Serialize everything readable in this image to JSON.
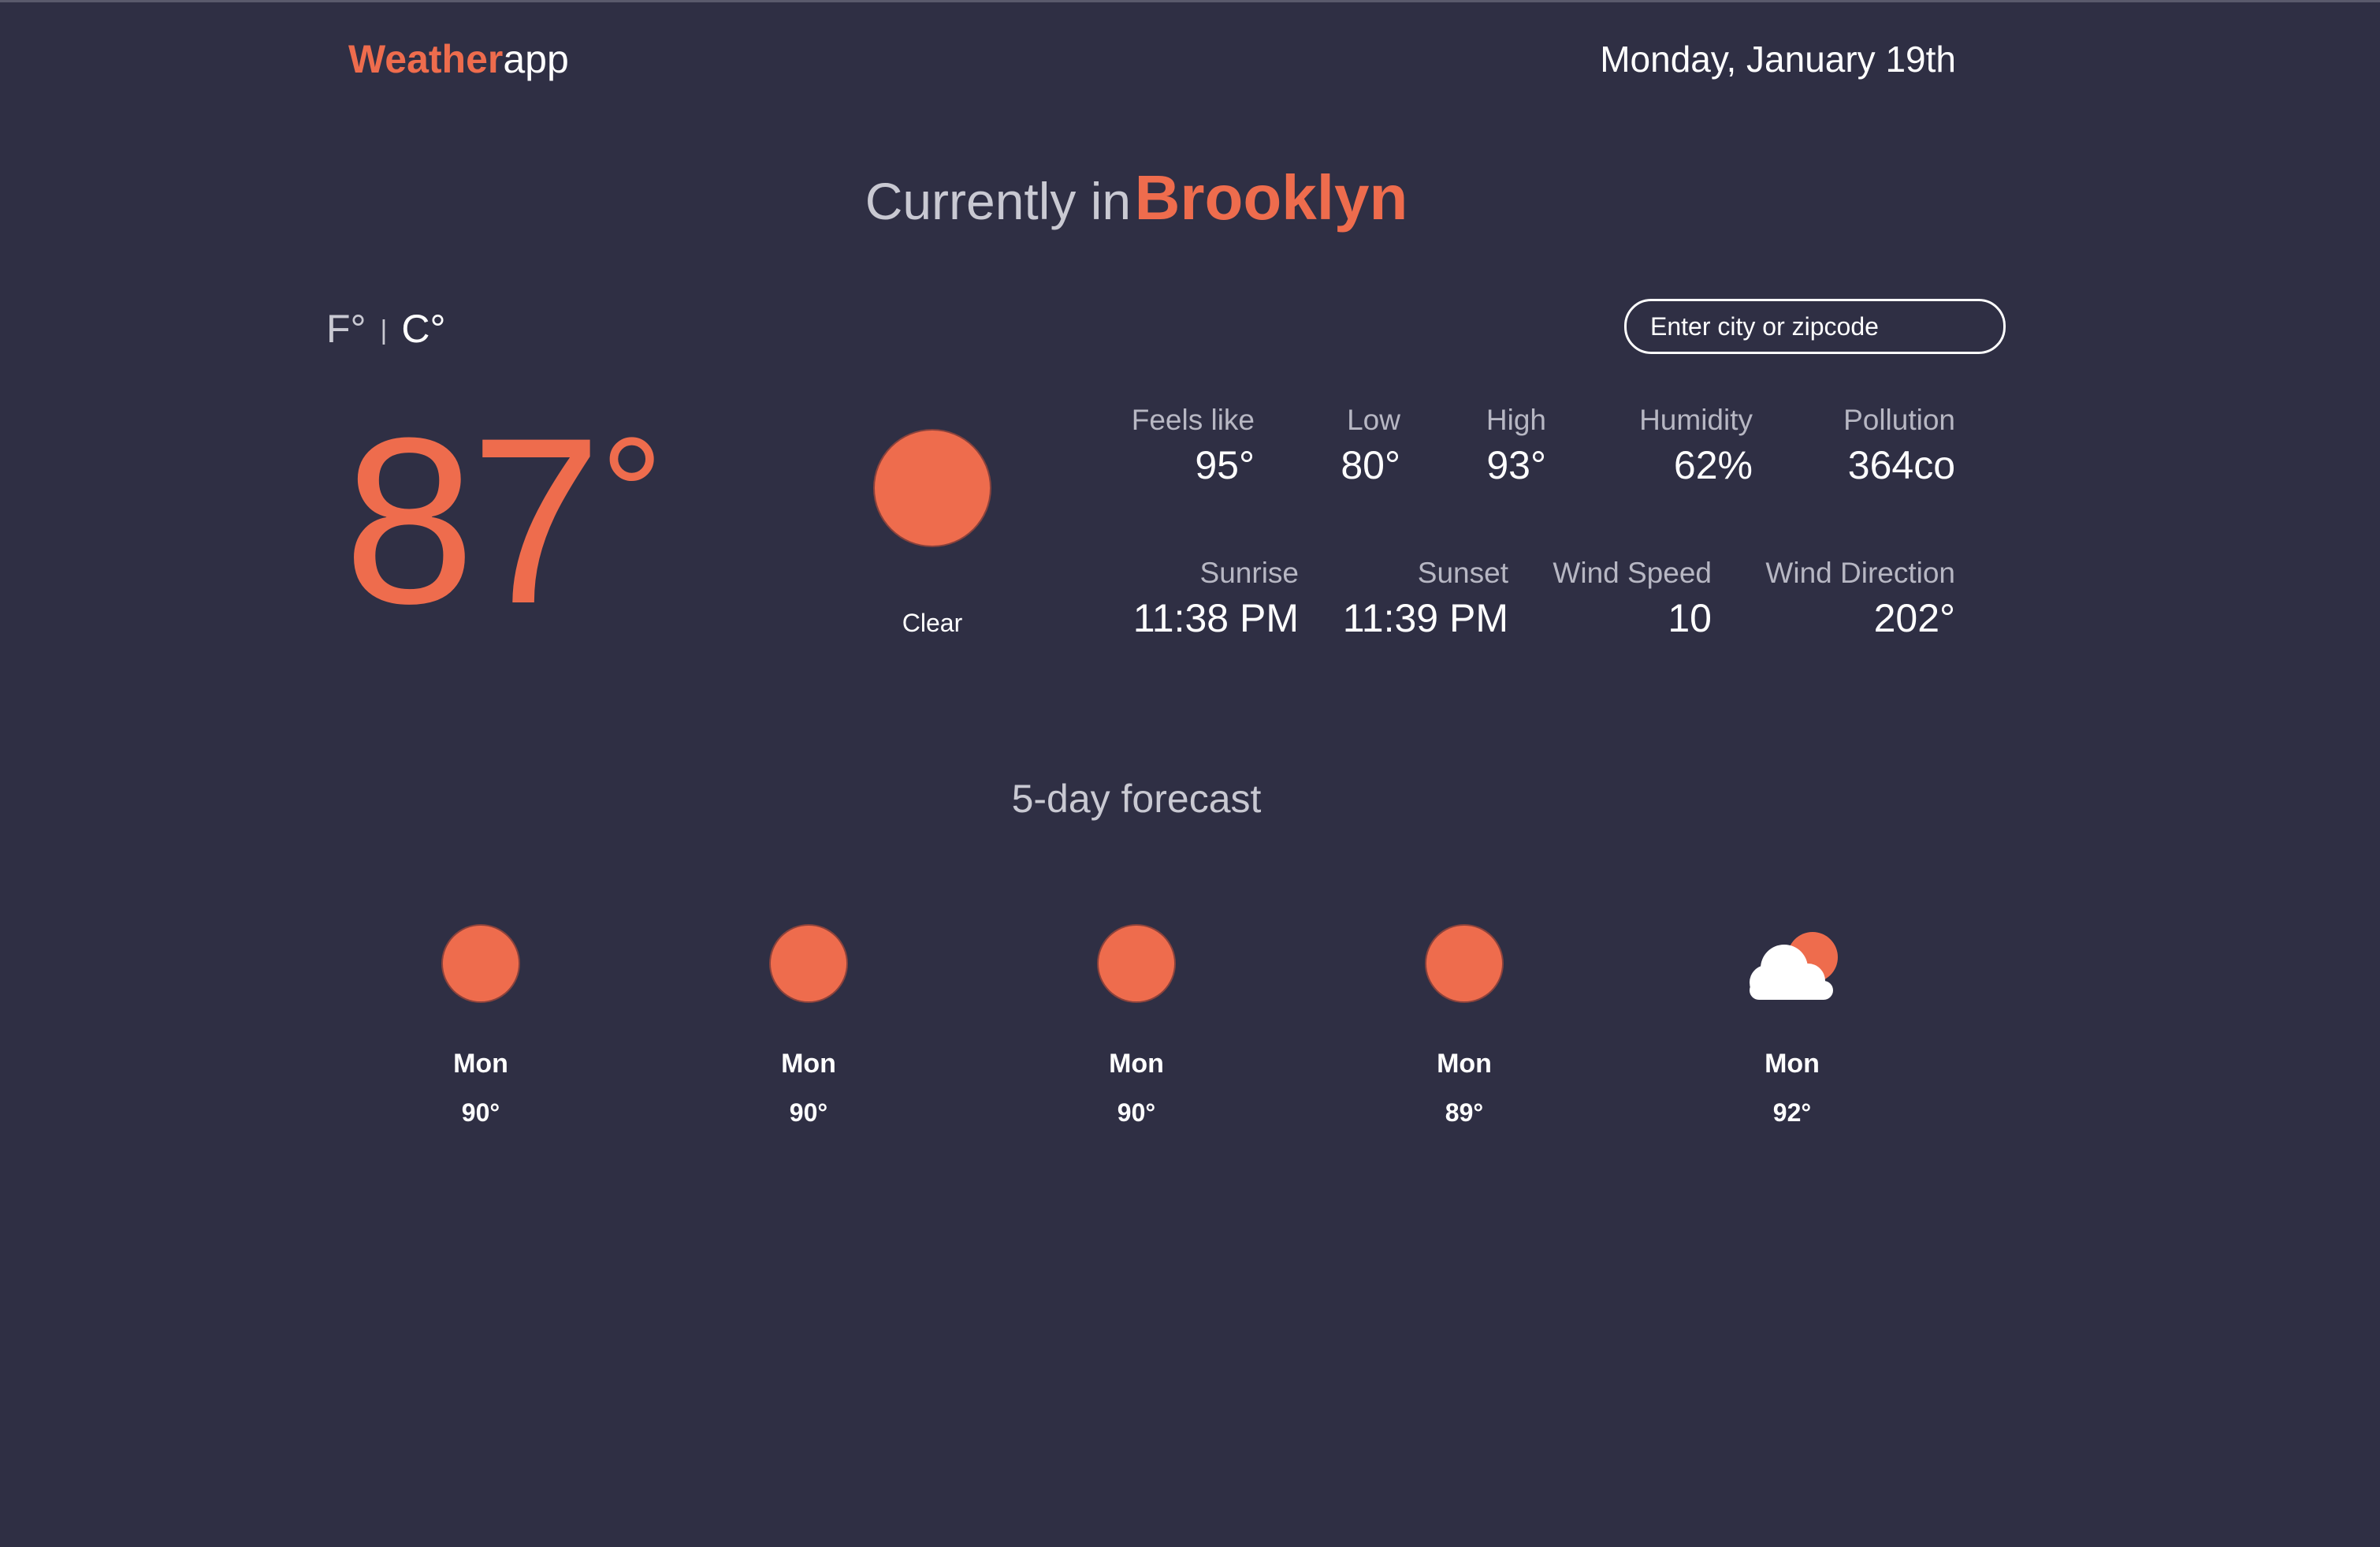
{
  "header": {
    "logo_strong": "Weather",
    "logo_light": "app",
    "date": "Monday, January 19th"
  },
  "headline": {
    "prefix": "Currently in",
    "city": "Brooklyn"
  },
  "units": {
    "fahrenheit": "F°",
    "separator": "|",
    "celsius": "C°"
  },
  "search": {
    "placeholder": "Enter city or zipcode"
  },
  "current": {
    "temperature": "87",
    "degree_symbol": "°",
    "condition": "Clear",
    "icon": "sun-icon"
  },
  "stats": {
    "feels_like": {
      "label": "Feels like",
      "value": "95°"
    },
    "low": {
      "label": "Low",
      "value": "80°"
    },
    "high": {
      "label": "High",
      "value": "93°"
    },
    "humidity": {
      "label": "Humidity",
      "value": "62%"
    },
    "pollution": {
      "label": "Pollution",
      "value": "364co"
    },
    "sunrise": {
      "label": "Sunrise",
      "value": "11:38 PM"
    },
    "sunset": {
      "label": "Sunset",
      "value": "11:39 PM"
    },
    "wind_speed": {
      "label": "Wind Speed",
      "value": "10"
    },
    "wind_direction": {
      "label": "Wind Direction",
      "value": "202°"
    }
  },
  "forecast": {
    "title": "5-day forecast",
    "days": [
      {
        "day": "Mon",
        "temp": "90°",
        "icon": "sun-icon"
      },
      {
        "day": "Mon",
        "temp": "90°",
        "icon": "sun-icon"
      },
      {
        "day": "Mon",
        "temp": "90°",
        "icon": "sun-icon"
      },
      {
        "day": "Mon",
        "temp": "89°",
        "icon": "sun-icon"
      },
      {
        "day": "Mon",
        "temp": "92°",
        "icon": "partly-cloudy-icon"
      }
    ]
  },
  "colors": {
    "background": "#2f2f44",
    "accent": "#ee6c4d",
    "muted_text": "#b7b7c3",
    "text": "#ffffff"
  }
}
